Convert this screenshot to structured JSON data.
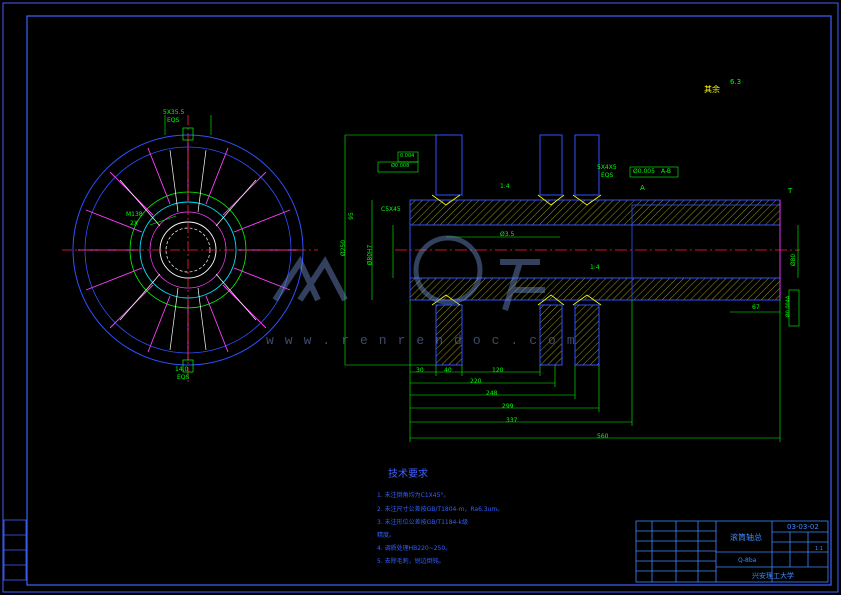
{
  "drawing": {
    "roughness_label": "其余",
    "roughness_value": "6.3",
    "title_block": {
      "part_name": "滚筒轴总",
      "material": "Q-8ba",
      "drawing_no": "03-03-02",
      "school": "兴安理工大学",
      "sheet_no": "1:1"
    }
  },
  "left_view_labels": {
    "top_key": "5X35.5",
    "top_key_sub": "EQS",
    "bottom_key": "14.0",
    "bottom_key_sub": "EQS",
    "thread_label": "M138",
    "thread_sub": "2X"
  },
  "dimensions": {
    "tol_box1": "0.004",
    "tol_box2": "Ø0.008",
    "key_label": "5X4X5",
    "key_sub": "EQS",
    "gdt_value": "Ø0.005",
    "gdt_datum": "A-B",
    "chamfer": "C5X45",
    "d_left": "Ø250",
    "d_bore": "Ø80H7",
    "len_95": "95",
    "center_len": "Ø3.5",
    "slope": "1:4",
    "slope2": "1:4",
    "d_right": "Ø80",
    "right_tol": "Ø0.004A",
    "len_67": "67",
    "d_30": "30",
    "d_40": "40",
    "d_120": "120",
    "d_220": "220",
    "d_248": "248",
    "d_299": "299",
    "d_337": "337",
    "d_560": "560",
    "mark_t": "T",
    "mark_a": "A"
  },
  "notes": {
    "title": "技术要求",
    "items": [
      "1. 未注倒角均为C1X45°。",
      "2. 未注尺寸公差按GB/T1804-m，Ra6.3um。",
      "3. 未注形位公差按GB/T1184-k级",
      "精度。",
      "4. 调质处理HB220~250。",
      "5. 去除毛刺，锐边倒钝。"
    ]
  },
  "watermark": "www.renrendoc.com",
  "colors": {
    "frame": "#4060ff",
    "outline": "#3050ff",
    "dimension": "#00ff00",
    "centerline": "#ff2040",
    "hatch": "#ffff00",
    "magenta": "#ff30ff",
    "cyan": "#00e0ff"
  }
}
